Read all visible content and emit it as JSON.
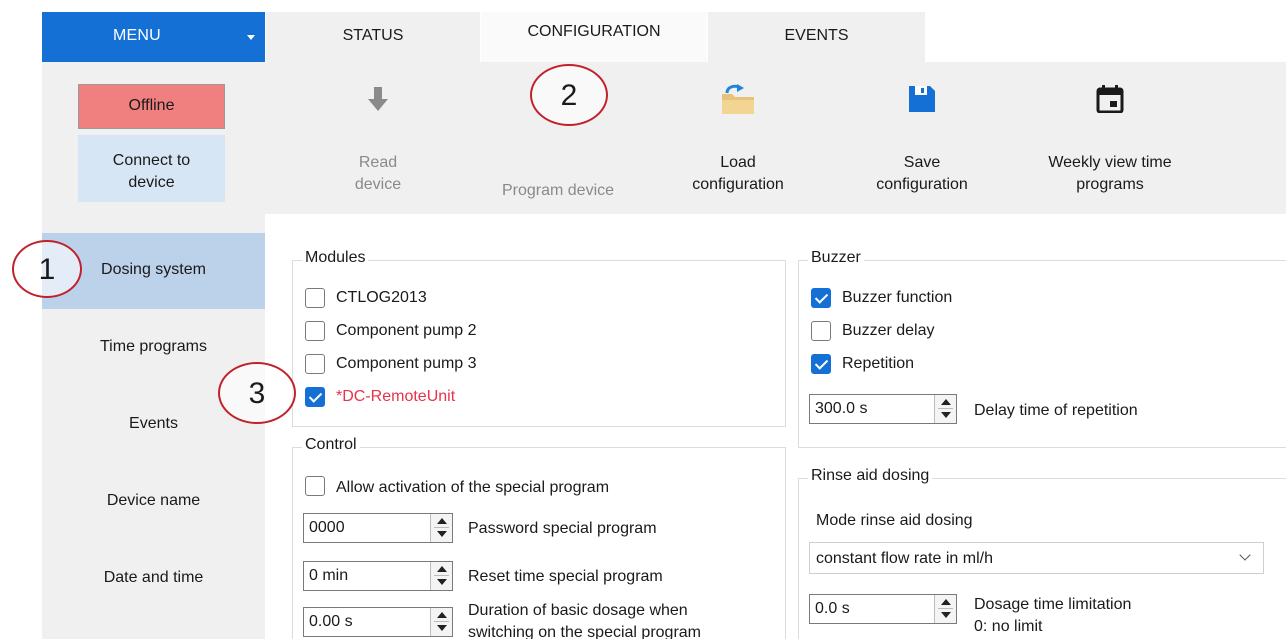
{
  "menu": {
    "label": "MENU"
  },
  "tabs": [
    {
      "label": "STATUS",
      "active": false
    },
    {
      "label": "CONFIGURATION",
      "active": true
    },
    {
      "label": "EVENTS",
      "active": false
    }
  ],
  "connection": {
    "status": "Offline",
    "connect_line1": "Connect to",
    "connect_line2": "device"
  },
  "toolbar": [
    {
      "line1": "Read",
      "line2": "device",
      "icon": "download-arrow-icon",
      "enabled": false
    },
    {
      "line1": "Program device",
      "line2": "",
      "icon": "program-device-icon",
      "enabled": false
    },
    {
      "line1": "Load",
      "line2": "configuration",
      "icon": "folder-load-icon",
      "enabled": true
    },
    {
      "line1": "Save",
      "line2": "configuration",
      "icon": "floppy-disk-icon",
      "enabled": true
    },
    {
      "line1": "Weekly view time",
      "line2": "programs",
      "icon": "calendar-icon",
      "enabled": true
    }
  ],
  "nav": [
    {
      "label": "Dosing system",
      "selected": true
    },
    {
      "label": "Time programs",
      "selected": false
    },
    {
      "label": "Events",
      "selected": false
    },
    {
      "label": "Device name",
      "selected": false
    },
    {
      "label": "Date and time",
      "selected": false
    }
  ],
  "modules": {
    "title": "Modules",
    "items": [
      {
        "label": "CTLOG2013",
        "checked": false
      },
      {
        "label": "Component pump 2",
        "checked": false
      },
      {
        "label": "Component pump 3",
        "checked": false
      },
      {
        "label": "*DC-RemoteUnit",
        "checked": true,
        "color": "#e8334a"
      }
    ]
  },
  "control": {
    "title": "Control",
    "allow_special": {
      "label": "Allow activation of the special program",
      "checked": false
    },
    "password": {
      "value": "0000",
      "label": "Password special program"
    },
    "reset_time": {
      "value": "0 min",
      "label": "Reset time special program"
    },
    "duration": {
      "value": "0.00 s",
      "label_line1": "Duration of basic dosage when",
      "label_line2": "switching on the special program"
    }
  },
  "buzzer": {
    "title": "Buzzer",
    "items": [
      {
        "label": "Buzzer function",
        "checked": true
      },
      {
        "label": "Buzzer delay",
        "checked": false
      },
      {
        "label": "Repetition",
        "checked": true
      }
    ],
    "delay": {
      "value": "300.0 s",
      "label": "Delay time of repetition"
    }
  },
  "rinse": {
    "title": "Rinse aid dosing",
    "mode_label": "Mode rinse aid dosing",
    "mode_value": "constant flow rate in ml/h",
    "limit": {
      "value": "0.0 s",
      "label_line1": "Dosage time limitation",
      "label_line2": "0: no limit"
    }
  },
  "annotations": [
    "1",
    "2",
    "3"
  ],
  "colors": {
    "accent": "#1570d6",
    "offline": "#f08080",
    "selected_nav": "#bcd1ea",
    "annotation": "#c0222b"
  }
}
